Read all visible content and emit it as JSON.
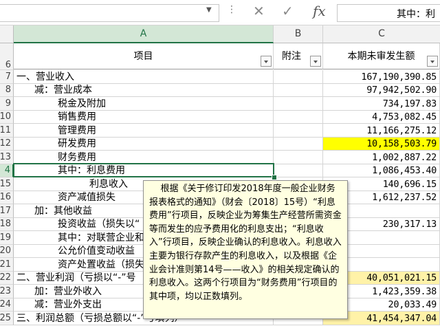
{
  "formula_bar": {
    "text": "其中：利",
    "cancel_icon": "close-icon",
    "enter_icon": "check-icon",
    "function_icon": "fx-icon",
    "fx_label": "fx",
    "dots": "⋮"
  },
  "columns": [
    {
      "letter": "A",
      "selected": true
    },
    {
      "letter": "B",
      "selected": false
    },
    {
      "letter": "C",
      "selected": false
    }
  ],
  "header_row": {
    "number": "6",
    "a": "项目",
    "b": "附注",
    "c": "本期未审发生额"
  },
  "rows": [
    {
      "number": "7",
      "a": "一、营业收入",
      "c": "167,190,390.85"
    },
    {
      "number": "8",
      "a": "减：营业成本",
      "c": "97,942,502.90"
    },
    {
      "number": "9",
      "a": "税金及附加",
      "c": "734,197.83"
    },
    {
      "number": "10",
      "a": "销售费用",
      "c": "4,753,082.45"
    },
    {
      "number": "11",
      "a": "管理费用",
      "c": "11,166,275.12"
    },
    {
      "number": "12",
      "a": "研发费用",
      "c": "10,158,503.79"
    },
    {
      "number": "13",
      "a": "财务费用",
      "c": "1,002,887.22"
    },
    {
      "number": "4",
      "a": "其中：利息费用",
      "c": "1,086,453.40"
    },
    {
      "number": "15",
      "a": "利息收入",
      "c": "140,696.15"
    },
    {
      "number": "16",
      "a": "资产减值损失",
      "c": "1,612,237.52"
    },
    {
      "number": "17",
      "a": "加：其他收益",
      "c": ""
    },
    {
      "number": "18",
      "a": "投资收益（损失以“",
      "c": "230,317.13"
    },
    {
      "number": "19",
      "a": "其中：对联营企业和",
      "c": ""
    },
    {
      "number": "20",
      "a": "公允价值变动收益",
      "c": ""
    },
    {
      "number": "21",
      "a": "资产处置收益（损失",
      "c": ""
    },
    {
      "number": "22",
      "a": "二、营业利润（亏损以“-”号",
      "c": "40,051,021.15"
    },
    {
      "number": "23",
      "a": "加：营业外收入",
      "c": "1,423,359.38"
    },
    {
      "number": "24",
      "a": "减：营业外支出",
      "c": "20,033.49"
    },
    {
      "number": "25",
      "a": "三、利润总额（亏损总额以“-”号填列）",
      "c": "41,454,347.04"
    }
  ],
  "comment": {
    "text": "    根据《关于修订印发2018年度一般企业财务报表格式的通知》（财会〔2018〕15号）“利息费用”行项目，反映企业为筹集生产经营所需资金等而发生的应予费用化的利息支出；“利息收入”行项目，反映企业确认的利息收入。利息收入主要为银行存款产生的利息收入，以及根据《企业会计准则第14号——收入》的相关规定确认的利息收入。这两个行项目为“财务费用”行项目的其中项，均以正数填列。"
  },
  "colors": {
    "highlight": "#ffff00",
    "light_highlight": "#fff2a8",
    "selection": "#217346",
    "comment_bg": "#ffffe1"
  }
}
